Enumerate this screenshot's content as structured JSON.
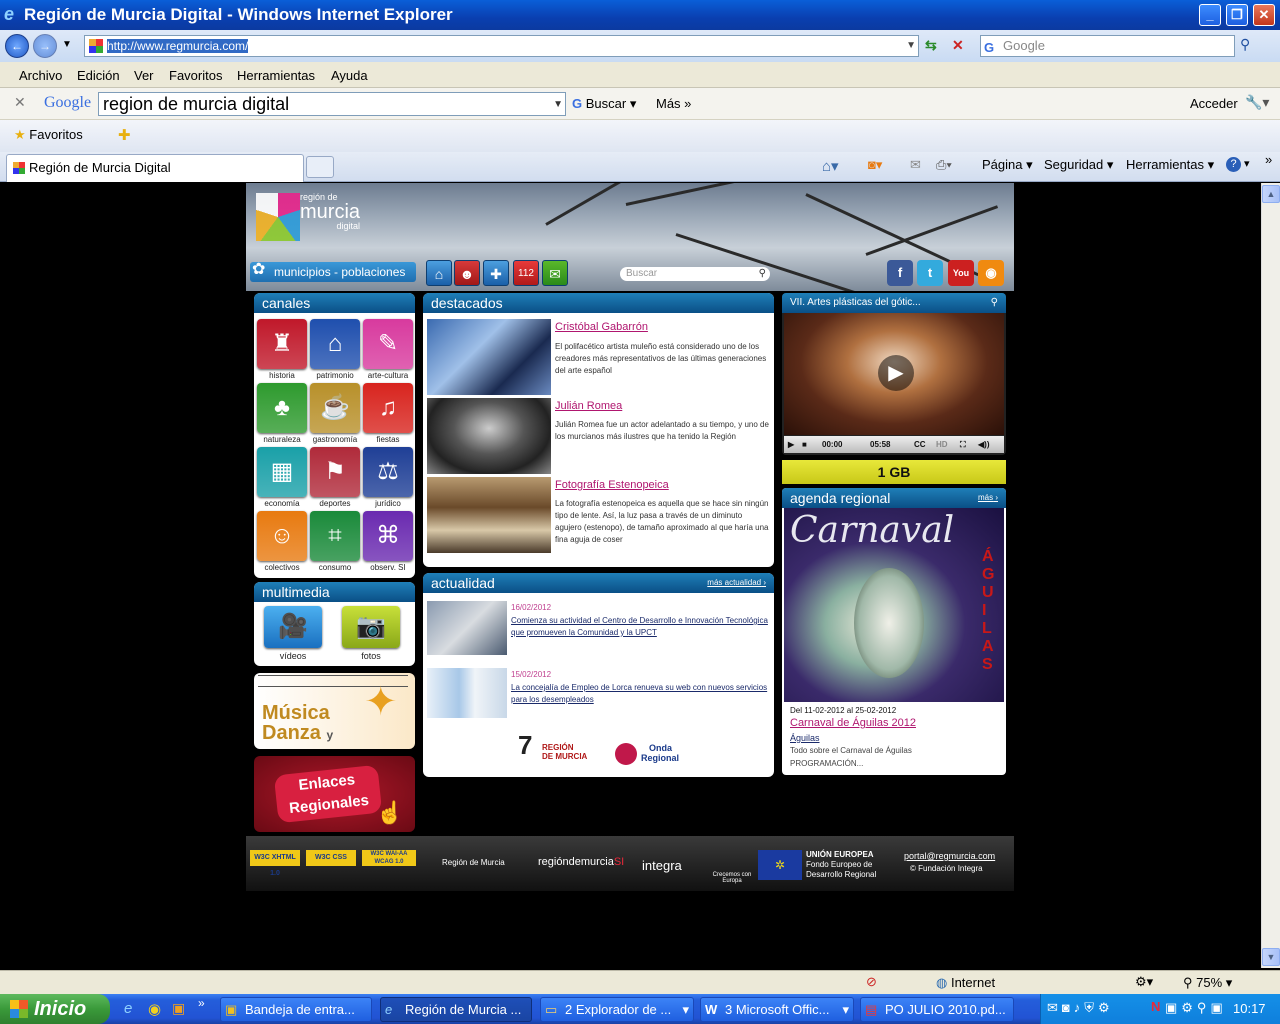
{
  "window": {
    "title": "Región de Murcia Digital - Windows Internet Explorer"
  },
  "address_bar": {
    "url": "http://www.regmurcia.com/",
    "search_placeholder": "Google"
  },
  "menu": [
    "Archivo",
    "Edición",
    "Ver",
    "Favoritos",
    "Herramientas",
    "Ayuda"
  ],
  "google_toolbar": {
    "logo": "Google",
    "query": "region de murcia digital",
    "search_label": "Buscar",
    "more_label": "Más",
    "signin_label": "Acceder"
  },
  "favorites": {
    "label": "Favoritos"
  },
  "tab": {
    "title": "Región de Murcia Digital"
  },
  "command_bar": {
    "page": "Página",
    "security": "Seguridad",
    "tools": "Herramientas"
  },
  "site": {
    "logo": {
      "line1": "región de",
      "line2": "murcia",
      "line3": "digital"
    },
    "municipios_label": "municipios - poblaciones",
    "search_placeholder": "Buscar",
    "top_icons": [
      "home-icon",
      "contact-icon",
      "plus-icon",
      "emergency-112-icon",
      "mail-icon"
    ],
    "social_icons": [
      "facebook-icon",
      "twitter-icon",
      "youtube-icon",
      "rss-icon"
    ],
    "canales": {
      "title": "canales",
      "items": [
        {
          "label": "historia",
          "color": "#c0182a",
          "icon": "coat-of-arms-icon"
        },
        {
          "label": "patrimonio",
          "color": "#1f4fae",
          "icon": "temple-icon"
        },
        {
          "label": "arte-cultura",
          "color": "#d83a9e",
          "icon": "palette-icon"
        },
        {
          "label": "naturaleza",
          "color": "#2e9a2e",
          "icon": "tree-icon"
        },
        {
          "label": "gastronomía",
          "color": "#b8902a",
          "icon": "chef-icon"
        },
        {
          "label": "fiestas",
          "color": "#d8241e",
          "icon": "dancers-icon"
        },
        {
          "label": "economía",
          "color": "#1aa0a8",
          "icon": "cash-register-icon"
        },
        {
          "label": "deportes",
          "color": "#b02a3a",
          "icon": "runner-icon"
        },
        {
          "label": "jurídico",
          "color": "#1f3f96",
          "icon": "scales-icon"
        },
        {
          "label": "colectivos",
          "color": "#e87a10",
          "icon": "people-icon"
        },
        {
          "label": "consumo",
          "color": "#1a8a3a",
          "icon": "basket-icon"
        },
        {
          "label": "observ. SI",
          "color": "#6a2ab0",
          "icon": "satellite-icon"
        }
      ]
    },
    "multimedia": {
      "title": "multimedia",
      "items": [
        {
          "label": "vídeos",
          "icon": "video-camera-icon"
        },
        {
          "label": "fotos",
          "icon": "photo-camera-icon"
        }
      ]
    },
    "musica_danza": {
      "line1": "Música",
      "line2": "Danza",
      "conj": "y"
    },
    "enlaces": {
      "line1": "Enlaces",
      "line2": "Regionales"
    },
    "destacados": {
      "title": "destacados",
      "items": [
        {
          "title": "Cristóbal Gabarrón",
          "desc": "El polifacético artista muleño está considerado uno de los creadores más representativos de las últimas generaciones del arte español"
        },
        {
          "title": "Julián Romea",
          "desc": "Julián Romea fue un actor adelantado a su tiempo, y uno de los murcianos más ilustres que ha tenido la Región"
        },
        {
          "title": "Fotografía Estenopeica",
          "desc": "La fotografía estenopeica es aquella que se hace sin ningún tipo de lente. Así, la luz pasa a través de un diminuto agujero (estenopo), de tamaño aproximado al que haría una fina aguja de coser"
        }
      ]
    },
    "actualidad": {
      "title": "actualidad",
      "more": "más actualidad",
      "items": [
        {
          "date": "16/02/2012",
          "title": "Comienza su actividad el Centro de Desarrollo e Innovación Tecnológica que promueven la Comunidad y la UPCT"
        },
        {
          "date": "15/02/2012",
          "title": "La concejalía de Empleo de Lorca renueva su web con nuevos servicios para los desempleados"
        }
      ],
      "logos": {
        "tv_num": "7",
        "tv_line1": "REGIÓN",
        "tv_line2": "DE MURCIA",
        "radio_line1": "Onda",
        "radio_line2": "Regional"
      }
    },
    "video": {
      "title": "VII. Artes plásticas del gótic...",
      "time": "00:00",
      "duration": "05:58",
      "cc": "CC",
      "hd": "HD"
    },
    "banner_1gb": "1 GB",
    "agenda": {
      "title": "agenda regional",
      "more": "más",
      "poster_title": "Carnaval",
      "poster_side": "ÁGUILAS",
      "dates": "Del 11-02-2012 al 25-02-2012",
      "event_title": "Carnaval de Águilas 2012",
      "place": "Águilas",
      "desc1": "Todo sobre el Carnaval de Águilas",
      "desc2": "PROGRAMACIÓN..."
    },
    "footer": {
      "badge1": "W3C XHTML 1.0",
      "badge2": "W3C CSS",
      "badge3": "W3C WAI-AA WCAG 1.0",
      "region": "Región de Murcia",
      "regionsi": "regióndemurcia",
      "regionsi_mark": "SI",
      "integra": "integra",
      "europa": "Crecemos con Europa",
      "ue_line1": "UNIÓN EUROPEA",
      "ue_line2": "Fondo Europeo de",
      "ue_line3": "Desarrollo Regional",
      "email": "portal@regmurcia.com",
      "copyright": "© Fundación Integra"
    }
  },
  "status_bar": {
    "zone": "Internet",
    "zoom": "75%"
  },
  "taskbar": {
    "start": "Inicio",
    "tasks": [
      "Bandeja de entra...",
      "Región de Murcia ...",
      "2 Explorador de ...",
      "3 Microsoft Offic...",
      "PO JULIO 2010.pd..."
    ],
    "clock": "10:17"
  }
}
